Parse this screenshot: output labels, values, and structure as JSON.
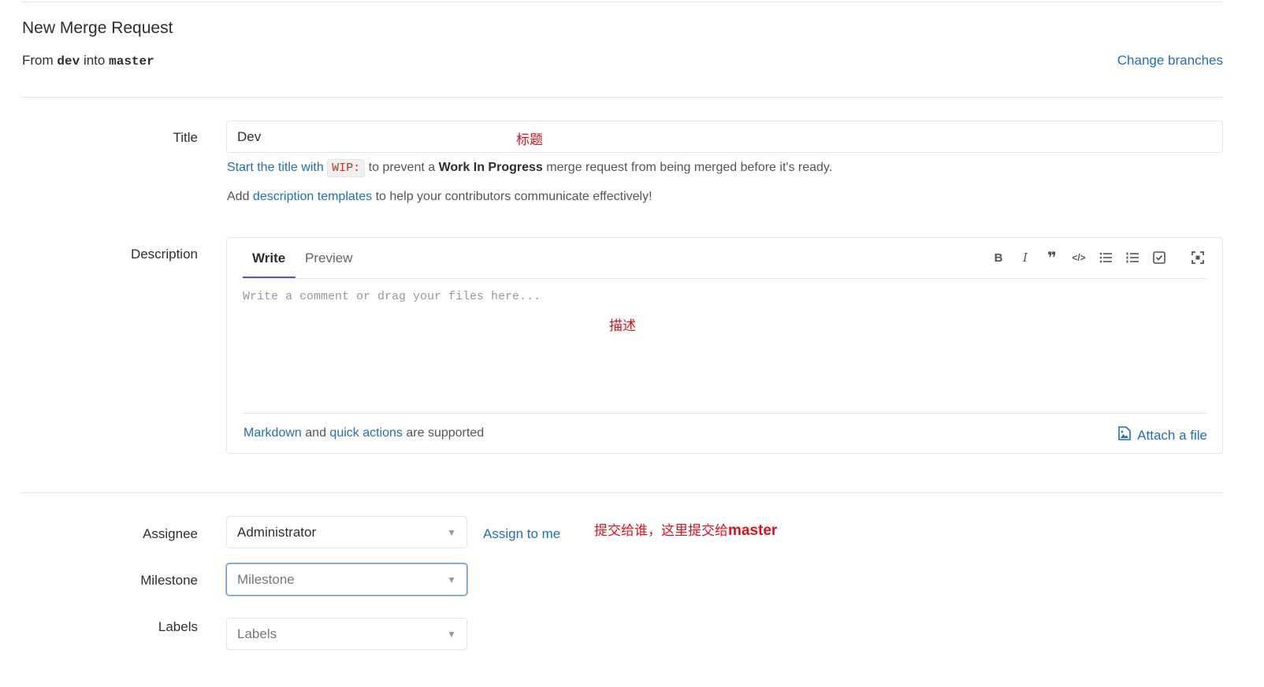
{
  "header": {
    "title": "New Merge Request",
    "from_prefix": "From",
    "source_branch": "dev",
    "into_word": "into",
    "target_branch": "master",
    "change_branches": "Change branches"
  },
  "title_field": {
    "label": "Title",
    "value": "Dev",
    "annotation": "标题",
    "wip_hint_link": "Start the title with",
    "wip_code": "WIP:",
    "wip_hint_mid": "to prevent a",
    "wip_hint_bold": "Work In Progress",
    "wip_hint_end": "merge request from being merged before it's ready.",
    "templates_prefix": "Add",
    "templates_link": "description templates",
    "templates_suffix": "to help your contributors communicate effectively!"
  },
  "description": {
    "label": "Description",
    "tab_write": "Write",
    "tab_preview": "Preview",
    "placeholder": "Write a comment or drag your files here...",
    "annotation": "描述",
    "markdown_link": "Markdown",
    "and_word": "and",
    "quick_actions_link": "quick actions",
    "supported_text": "are supported",
    "attach_label": "Attach a file",
    "toolbar": [
      "bold-icon",
      "italic-icon",
      "quote-icon",
      "code-icon",
      "bullet-list-icon",
      "numbered-list-icon",
      "task-list-icon",
      "fullscreen-icon"
    ]
  },
  "assignee": {
    "label": "Assignee",
    "value": "Administrator",
    "assign_to_me": "Assign to me",
    "annotation_cn": "提交给谁，这里提交给",
    "annotation_en": "master"
  },
  "milestone": {
    "label": "Milestone",
    "placeholder": "Milestone"
  },
  "labels": {
    "label": "Labels",
    "placeholder": "Labels"
  },
  "colors": {
    "link": "#1f6fb9",
    "annotation": "#e0101a",
    "tab_active": "#6b4fbb",
    "border": "#e5e5e5"
  }
}
